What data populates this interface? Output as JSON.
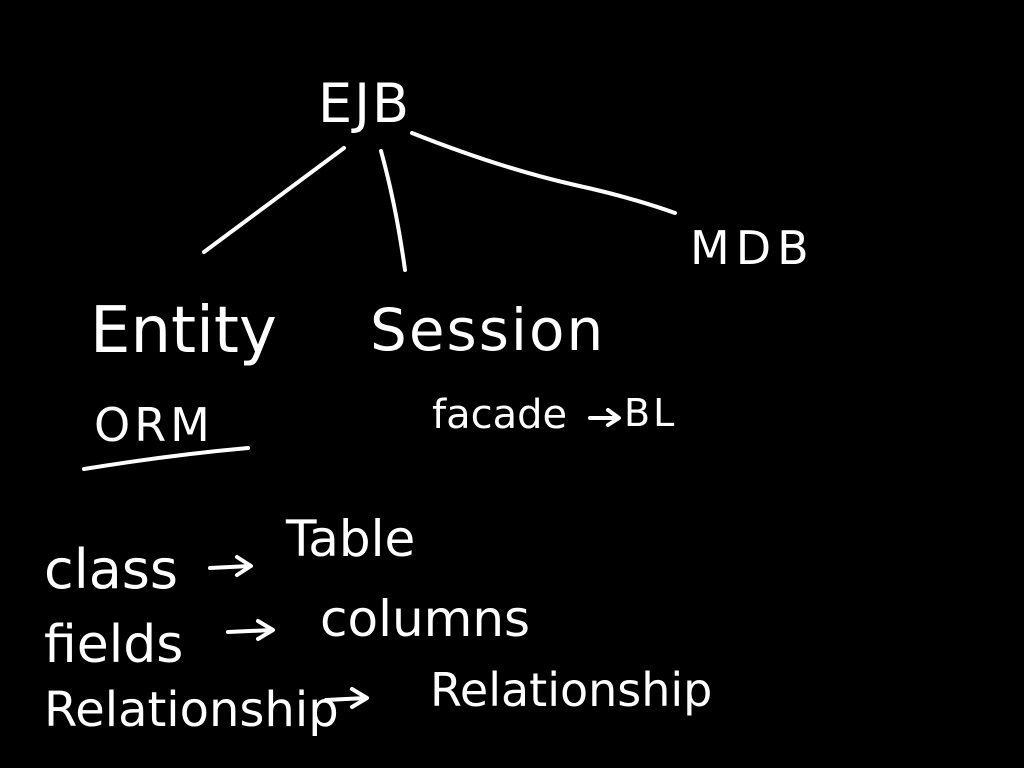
{
  "colors": {
    "background": "#000000",
    "ink": "#ffffff"
  },
  "tree": {
    "root": "EJB",
    "children": [
      "Entity",
      "Session",
      "MDB"
    ]
  },
  "entity_note": "ORM",
  "session_note": {
    "left": "facade",
    "right": "BL"
  },
  "mappings": [
    {
      "from": "class",
      "to": "Table"
    },
    {
      "from": "fields",
      "to": "columns"
    },
    {
      "from": "Relationship",
      "to": "Relationship"
    }
  ]
}
